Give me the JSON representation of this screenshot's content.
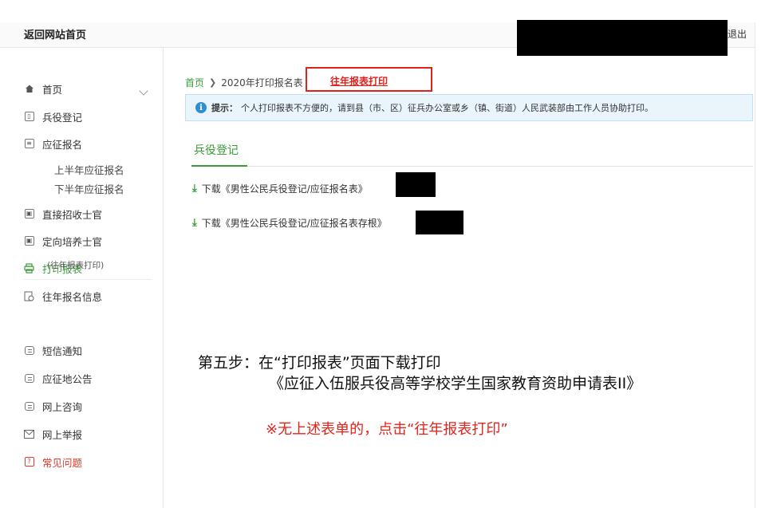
{
  "topbar": {
    "home_link": "返回网站首页",
    "logout": "退出"
  },
  "sidebar": {
    "items": [
      {
        "label": "首页",
        "icon": "home-icon"
      },
      {
        "label": "兵役登记",
        "icon": "register-icon"
      },
      {
        "label": "应征报名",
        "icon": "form-icon"
      },
      {
        "label": "直接招收士官",
        "icon": "id-card-icon"
      },
      {
        "label": "定向培养士官",
        "icon": "id-card-icon"
      },
      {
        "label": "打印报表",
        "icon": "printer-icon"
      },
      {
        "label": "往年报名信息",
        "icon": "history-icon"
      },
      {
        "label": "短信通知",
        "icon": "message-icon"
      },
      {
        "label": "应征地公告",
        "icon": "message-icon"
      },
      {
        "label": "网上咨询",
        "icon": "message-icon"
      },
      {
        "label": "网上举报",
        "icon": "mail-icon"
      },
      {
        "label": "常见问题",
        "icon": "question-icon"
      }
    ],
    "sub_items": [
      "上半年应征报名",
      "下半年应征报名"
    ],
    "history_note": "(往年报表打印)"
  },
  "breadcrumb": {
    "home": "首页",
    "current": "2020年打印报名表",
    "history_link": "往年报表打印"
  },
  "tip": {
    "title": "提示：",
    "text": "个人打印报表不方便的，请到县（市、区）征兵办公室或乡（镇、街道）人民武装部由工作人员协助打印。"
  },
  "tab": {
    "label": "兵役登记"
  },
  "downloads": [
    {
      "label": "下载《男性公民兵役登记/应征报名表》"
    },
    {
      "label": "下载《男性公民兵役登记/应征报名表存根》"
    }
  ],
  "annotation": {
    "step_line1": "第五步：在“打印报表”页面下载打印",
    "step_line2": "《应征入伍服兵役高等学校学生国家教育资助申请表II》",
    "notice": "※无上述表单的，点击“往年报表打印”"
  },
  "colors": {
    "accent_green": "#3a9b3a",
    "highlight_red": "#e0201a"
  }
}
